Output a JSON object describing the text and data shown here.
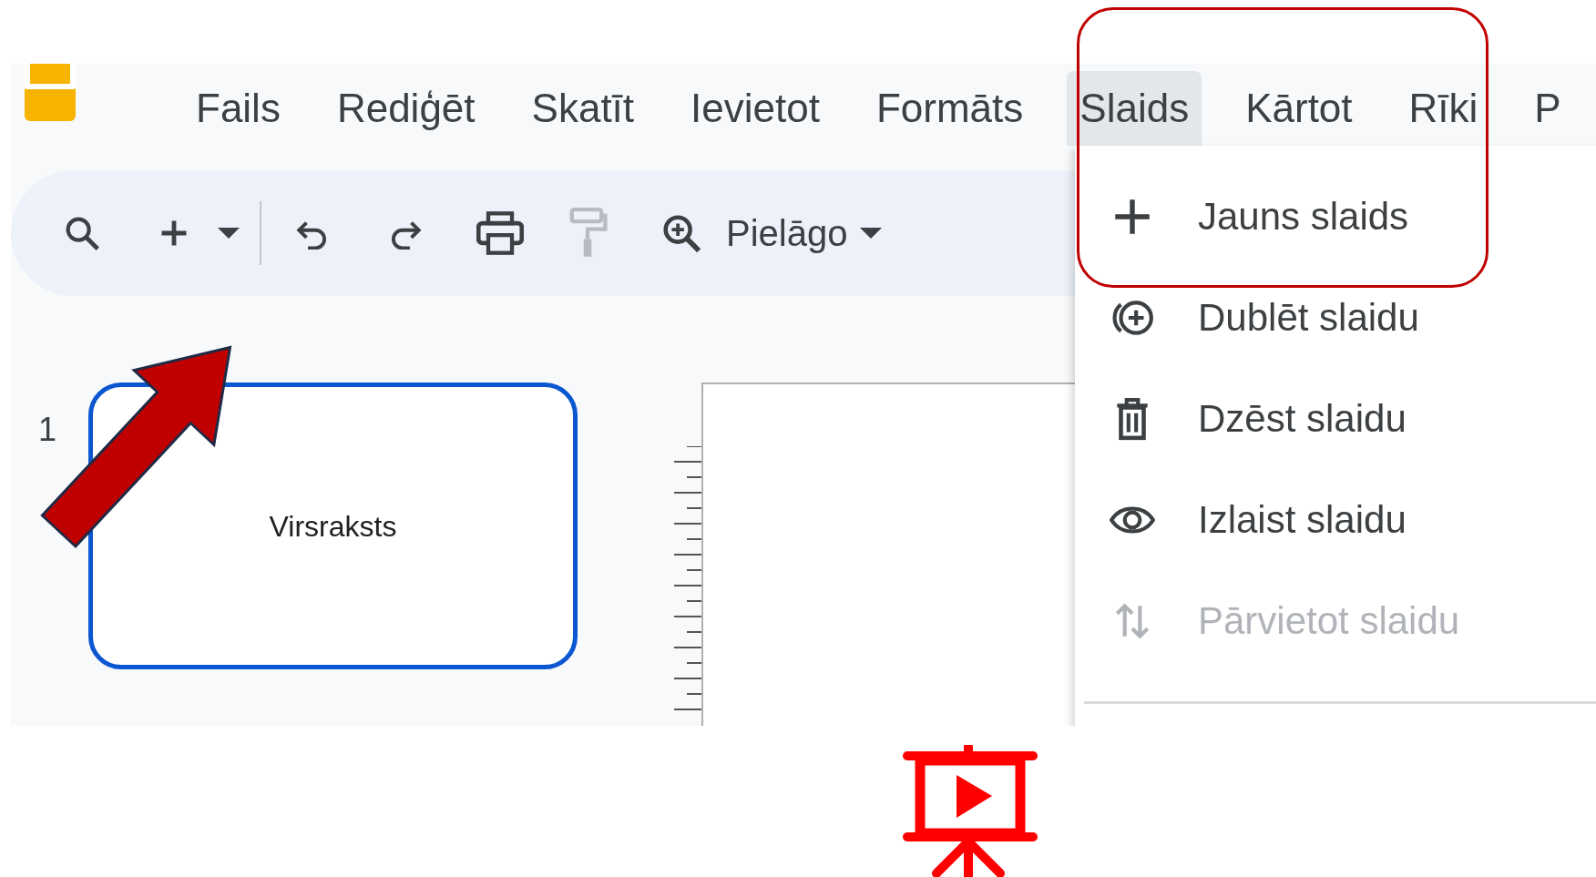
{
  "menu_bar": {
    "items": [
      {
        "label": "Fails",
        "selected": false
      },
      {
        "label": "Rediģēt",
        "selected": false
      },
      {
        "label": "Skatīt",
        "selected": false
      },
      {
        "label": "Ievietot",
        "selected": false
      },
      {
        "label": "Formāts",
        "selected": false
      },
      {
        "label": "Slaids",
        "selected": true
      },
      {
        "label": "Kārtot",
        "selected": false
      },
      {
        "label": "Rīki",
        "selected": false
      },
      {
        "label": "P",
        "selected": false
      }
    ]
  },
  "toolbar": {
    "zoom": "Pielāgo"
  },
  "slides": [
    {
      "number": "1",
      "title": "Virsraksts",
      "selected": true
    }
  ],
  "dropdown": {
    "items": [
      {
        "label": "Jauns slaids",
        "kind": "new",
        "disabled": false
      },
      {
        "label": "Dublēt slaidu",
        "kind": "duplicate",
        "disabled": false
      },
      {
        "label": "Dzēst slaidu",
        "kind": "delete",
        "disabled": false
      },
      {
        "label": "Izlaist slaidu",
        "kind": "skip",
        "disabled": false
      },
      {
        "label": "Pārvietot slaidu",
        "kind": "move",
        "disabled": true
      }
    ]
  }
}
